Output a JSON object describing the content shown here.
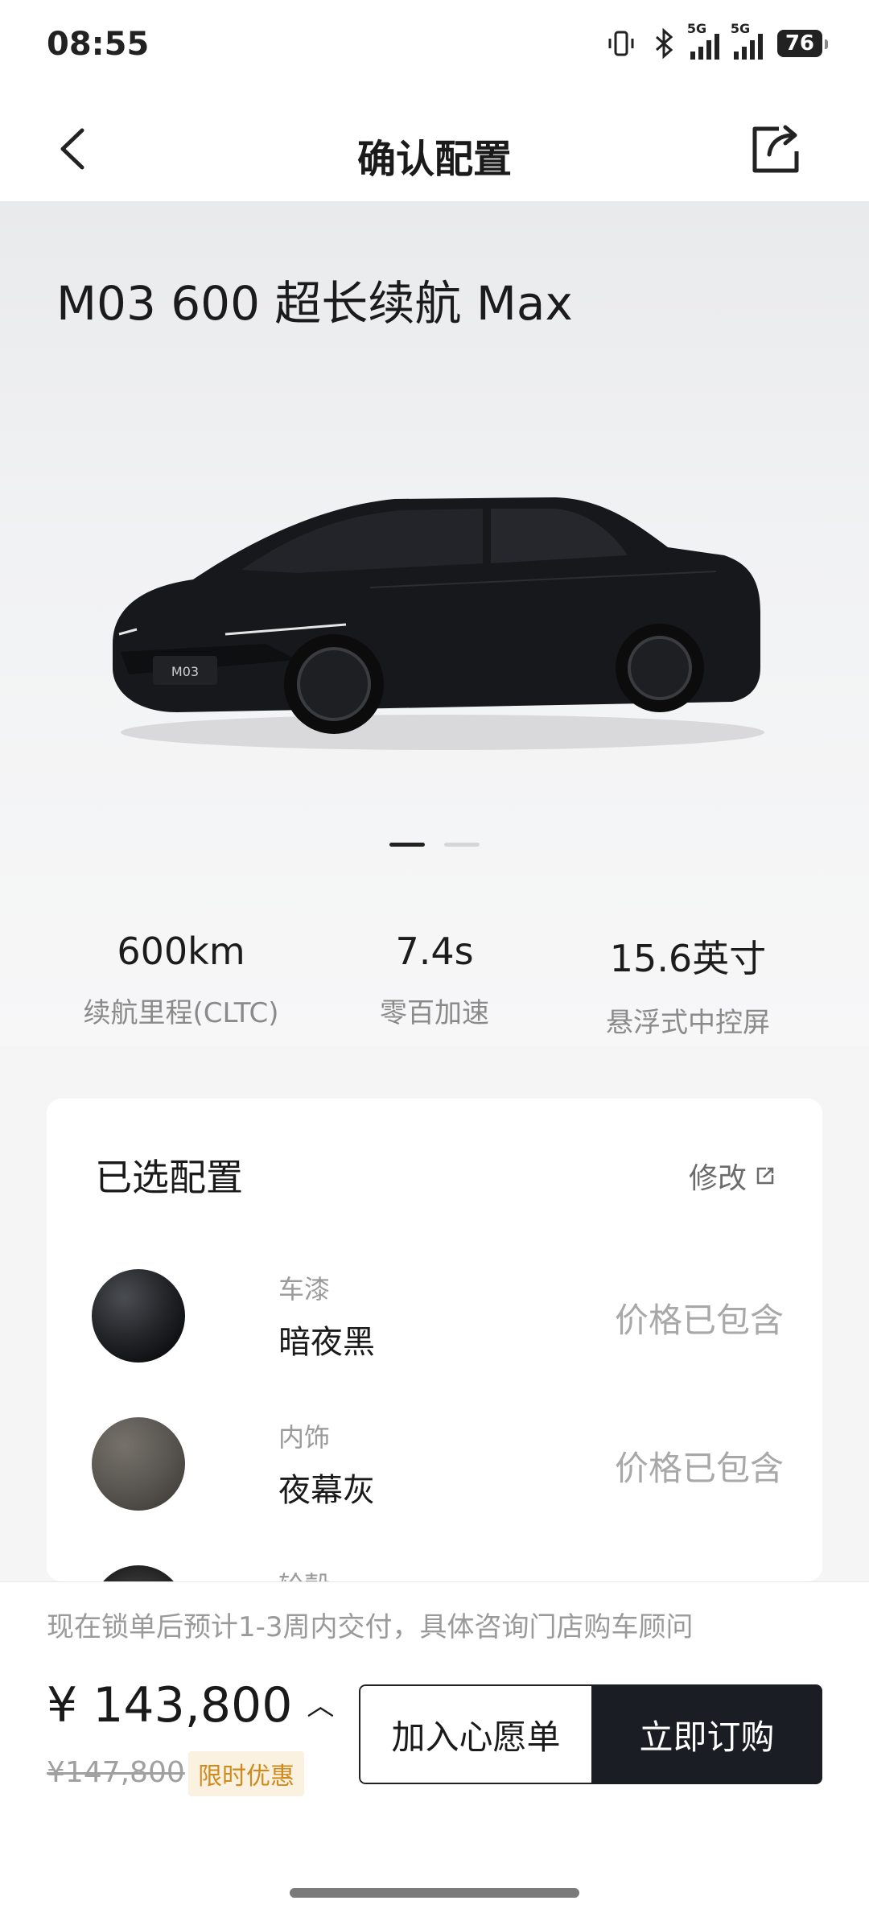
{
  "status": {
    "time": "08:55",
    "signal1": "5G",
    "signal2": "5G",
    "battery": "76"
  },
  "nav": {
    "title": "确认配置"
  },
  "hero": {
    "model_name": "M03 600 超长续航 Max",
    "plate": "M03",
    "slides_total": 2,
    "slide_active": 1
  },
  "specs": [
    {
      "value": "600km",
      "label": "续航里程(CLTC)"
    },
    {
      "value": "7.4s",
      "label": "零百加速"
    },
    {
      "value": "15.6英寸",
      "label": "悬浮式中控屏"
    }
  ],
  "config": {
    "title": "已选配置",
    "edit_label": "修改",
    "options": [
      {
        "category": "车漆",
        "value": "暗夜黑",
        "price": "价格已包含",
        "swatch": "#2a2c30"
      },
      {
        "category": "内饰",
        "value": "夜幕灰",
        "price": "价格已包含",
        "swatch": "#5b5753"
      },
      {
        "category": "轮毂",
        "value": "",
        "price": "",
        "swatch": "#3a3a3a"
      }
    ]
  },
  "footer": {
    "delivery_note": "现在锁单后预计1-3周内交付，具体咨询门店购车顾问",
    "price": "¥ 143,800",
    "original_price": "¥147,800",
    "promo_tag": "限时优惠",
    "wishlist_label": "加入心愿单",
    "order_label": "立即订购"
  },
  "colors": {
    "accent_dark": "#1a1e24",
    "promo": "#d08a1c"
  }
}
